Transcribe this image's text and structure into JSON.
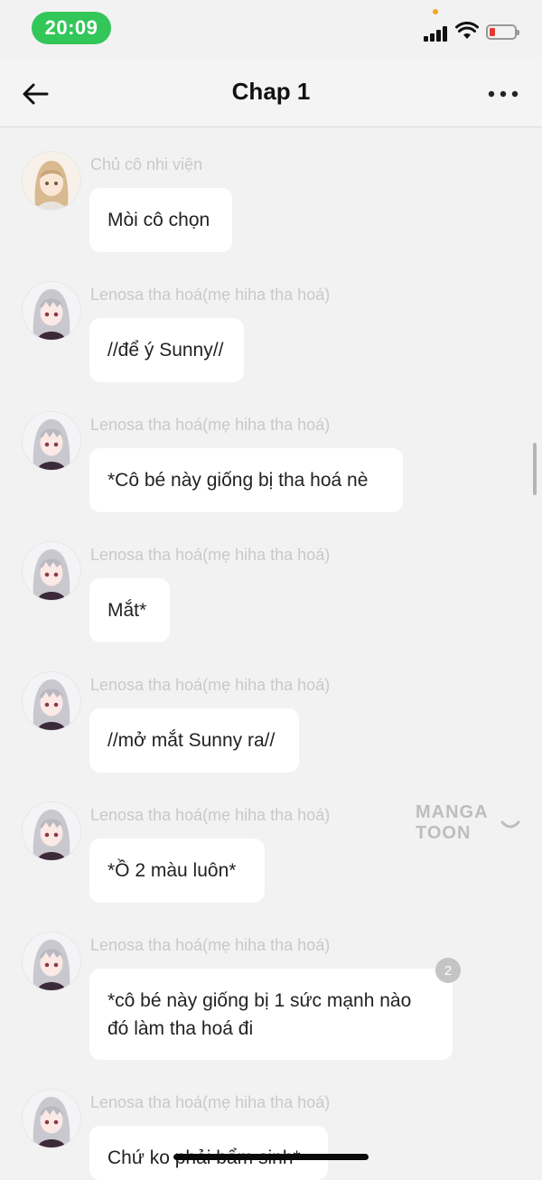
{
  "status_bar": {
    "time": "20:09"
  },
  "header": {
    "title": "Chap 1"
  },
  "messages": [
    {
      "sender": "Chủ cô nhi viện",
      "text": "Mòi cô chọn"
    },
    {
      "sender": "Lenosa tha hoá(mẹ hiha tha hoá)",
      "text": "//để ý Sunny//"
    },
    {
      "sender": "Lenosa tha hoá(mẹ hiha tha hoá)",
      "text": "*Cô bé này giống bị tha hoá nè"
    },
    {
      "sender": "Lenosa tha hoá(mẹ hiha tha hoá)",
      "text": "Mắt*"
    },
    {
      "sender": "Lenosa tha hoá(mẹ hiha tha hoá)",
      "text": "//mở mắt Sunny ra//"
    },
    {
      "sender": "Lenosa tha hoá(mẹ hiha tha hoá)",
      "text": "*Ồ 2 màu luôn*"
    },
    {
      "sender": "Lenosa tha hoá(mẹ hiha tha hoá)",
      "text_line1": "*cô bé này giống bị 1 sức mạnh nào",
      "text_line2": "đó làm tha hoá đi",
      "badge": "2"
    },
    {
      "sender": "Lenosa tha hoá(mẹ hiha tha hoá)",
      "text": "Chứ ko phải bẩm sinh*"
    }
  ],
  "watermark": "MANGA TOON",
  "icons": {
    "back": "arrow-left-icon",
    "more": "ellipsis-icon",
    "signal": "cellular-signal-icon",
    "wifi": "wifi-icon",
    "battery": "battery-low-icon"
  },
  "colors": {
    "time_pill": "#33c659",
    "battery_low": "#e53935",
    "bubble": "#ffffff",
    "background": "#f2f2f2"
  }
}
